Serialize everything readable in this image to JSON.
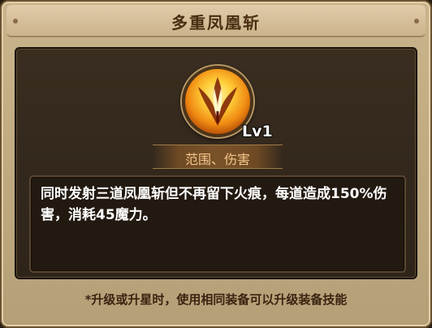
{
  "dialog": {
    "title": "多重凤凰斩"
  },
  "skill": {
    "icon": "phoenix-feather-icon",
    "level": "Lv1",
    "category": "范围、伤害",
    "description": "同时发射三道凤凰斩但不再留下火痕，每道造成150%伤害，消耗45魔力。"
  },
  "footer": {
    "note": "*升级或升星时，使用相同装备可以升级装备技能"
  },
  "colors": {
    "title_text": "#4a2e12",
    "category_text": "#f3c58a",
    "description_text": "#ffffff",
    "frame": "#c9b48c",
    "panel": "#3a2d20"
  }
}
